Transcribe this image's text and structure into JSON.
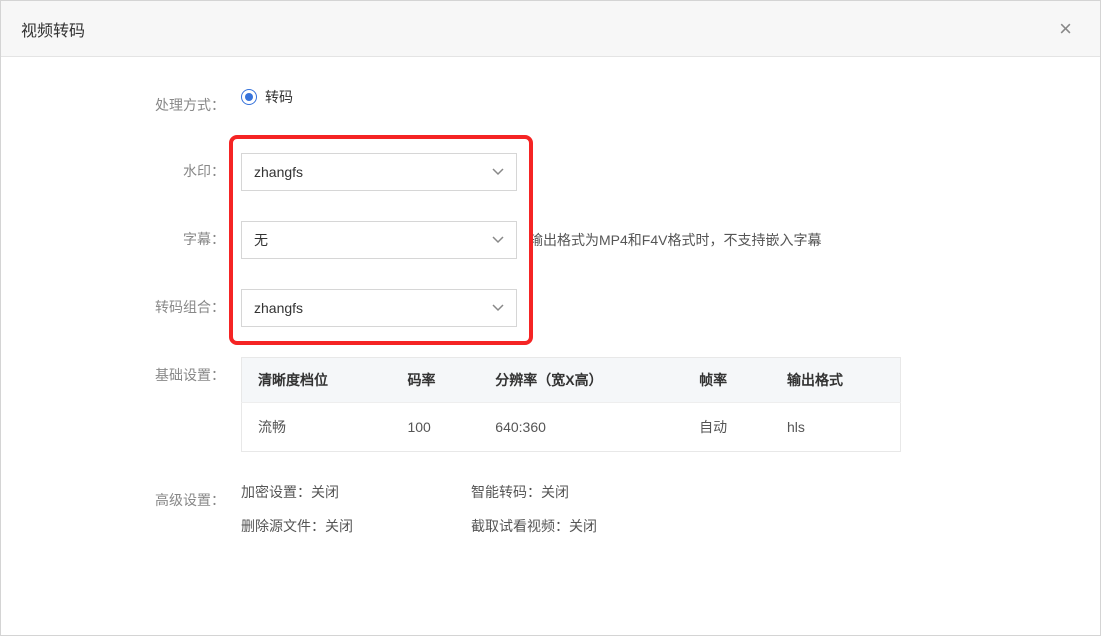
{
  "modal": {
    "title": "视频转码",
    "close": "×"
  },
  "form": {
    "process_mode_label": "处理方式：",
    "process_mode_option": "转码",
    "watermark_label": "水印：",
    "watermark_value": "zhangfs",
    "subtitle_label": "字幕：",
    "subtitle_value": "无",
    "subtitle_hint": "输出格式为MP4和F4V格式时，不支持嵌入字幕",
    "transcode_group_label": "转码组合：",
    "transcode_group_value": "zhangfs",
    "basic_settings_label": "基础设置：",
    "advanced_settings_label": "高级设置："
  },
  "table": {
    "headers": {
      "clarity": "清晰度档位",
      "bitrate": "码率",
      "resolution": "分辨率（宽X高）",
      "fps": "帧率",
      "format": "输出格式"
    },
    "row": {
      "clarity": "流畅",
      "bitrate": "100",
      "resolution": "640:360",
      "fps": "自动",
      "format": "hls"
    }
  },
  "advanced": {
    "encrypt_key": "加密设置：",
    "encrypt_val": "关闭",
    "smart_key": "智能转码：",
    "smart_val": "关闭",
    "delete_key": "删除源文件：",
    "delete_val": "关闭",
    "preview_key": "截取试看视频：",
    "preview_val": "关闭"
  }
}
